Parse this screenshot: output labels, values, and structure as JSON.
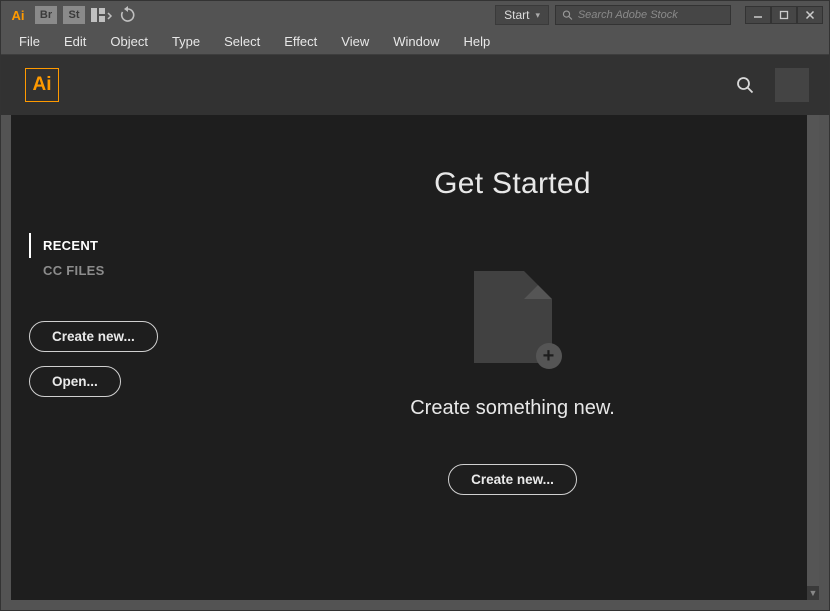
{
  "titlebar": {
    "app_badge": "Ai",
    "br_badge": "Br",
    "st_badge": "St",
    "workspace_label": "Start",
    "search_placeholder": "Search Adobe Stock"
  },
  "menu": {
    "items": [
      "File",
      "Edit",
      "Object",
      "Type",
      "Select",
      "Effect",
      "View",
      "Window",
      "Help"
    ]
  },
  "work_header": {
    "logo_text": "Ai"
  },
  "sidebar": {
    "items": [
      {
        "label": "RECENT",
        "active": true
      },
      {
        "label": "CC FILES",
        "active": false
      }
    ],
    "create_label": "Create new...",
    "open_label": "Open..."
  },
  "main": {
    "heading": "Get Started",
    "subtext": "Create something new.",
    "create_label": "Create new..."
  },
  "colors": {
    "accent": "#ff9a00",
    "panel_dark": "#1e1e1e",
    "panel_mid": "#323232",
    "chrome": "#535353"
  }
}
